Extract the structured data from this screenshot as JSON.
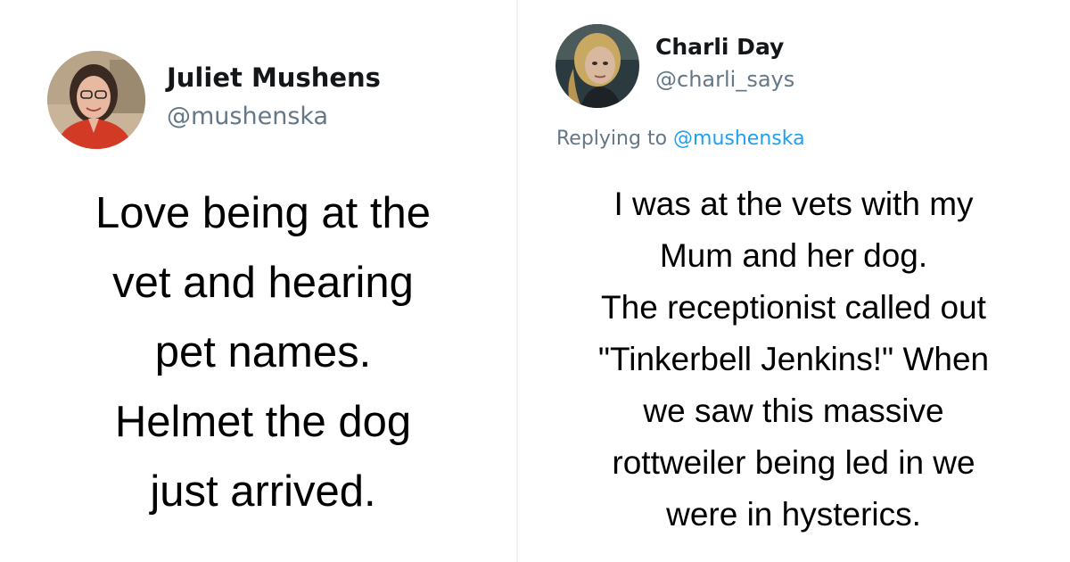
{
  "left_tweet": {
    "display_name": "Juliet Mushens",
    "handle": "@mushenska",
    "text_lines": [
      "Love being at the",
      "vet and hearing",
      "pet names.",
      "Helmet the dog",
      "just arrived."
    ]
  },
  "right_tweet": {
    "display_name": "Charli Day",
    "handle": "@charli_says",
    "replying_prefix": "Replying to ",
    "replying_to": "@mushenska",
    "text_lines": [
      "I was at the vets with my",
      "Mum and her dog.",
      "The receptionist called out",
      "\"Tinkerbell Jenkins!\" When",
      "we saw this massive",
      "rottweiler being led in we",
      "were in hysterics."
    ]
  },
  "colors": {
    "name": "#14171a",
    "handle": "#657786",
    "mention": "#1da1f2",
    "body_text": "#000000"
  }
}
